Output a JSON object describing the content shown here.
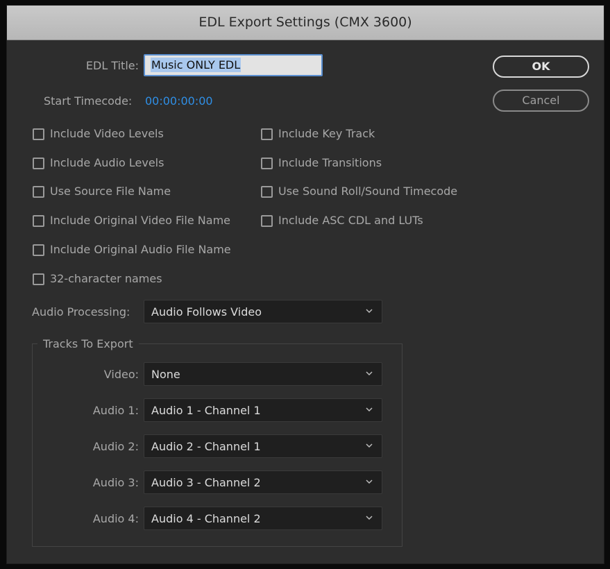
{
  "window": {
    "title": "EDL Export Settings (CMX 3600)"
  },
  "edl_title": {
    "label": "EDL Title:",
    "value": "Music ONLY EDL"
  },
  "start_timecode": {
    "label": "Start Timecode:",
    "value": "00:00:00:00"
  },
  "buttons": {
    "ok": "OK",
    "cancel": "Cancel"
  },
  "options_left": [
    {
      "label": "Include Video Levels",
      "checked": false
    },
    {
      "label": "Include Audio Levels",
      "checked": false
    },
    {
      "label": "Use Source File Name",
      "checked": false
    },
    {
      "label": "Include Original Video File Name",
      "checked": false
    },
    {
      "label": "Include Original Audio File Name",
      "checked": false
    },
    {
      "label": "32-character names",
      "checked": false
    }
  ],
  "options_right": [
    {
      "label": "Include Key Track",
      "checked": false
    },
    {
      "label": "Include Transitions",
      "checked": false
    },
    {
      "label": "Use Sound Roll/Sound Timecode",
      "checked": false
    },
    {
      "label": "Include ASC CDL and LUTs",
      "checked": false
    }
  ],
  "audio_processing": {
    "label": "Audio Processing:",
    "value": "Audio Follows Video"
  },
  "tracks": {
    "group_title": "Tracks To Export",
    "rows": [
      {
        "label": "Video:",
        "value": "None"
      },
      {
        "label": "Audio 1:",
        "value": "Audio 1 - Channel 1"
      },
      {
        "label": "Audio 2:",
        "value": "Audio 2 - Channel 1"
      },
      {
        "label": "Audio 3:",
        "value": "Audio 3 - Channel 2"
      },
      {
        "label": "Audio 4:",
        "value": "Audio 4 - Channel 2"
      }
    ]
  },
  "colors": {
    "dialog_bg": "#2d2d2d",
    "timecode": "#2f8fe6",
    "selection": "#a9c8ee"
  }
}
